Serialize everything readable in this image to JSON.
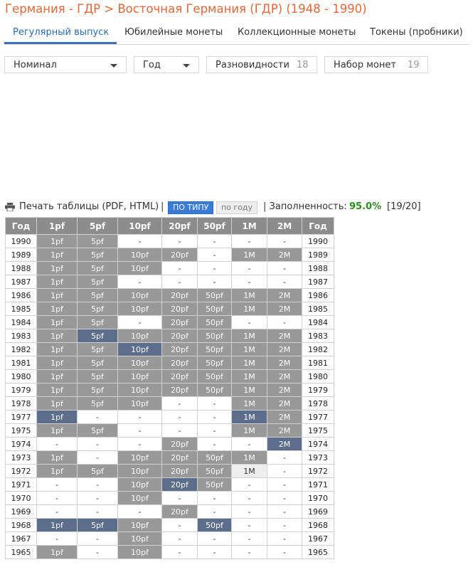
{
  "header": {
    "country": "Германия - ГДР",
    "separator": ">",
    "period": "Восточная Германия (ГДР) (1948 - 1990)"
  },
  "tabs": [
    {
      "label": "Регулярный выпуск",
      "active": true
    },
    {
      "label": "Юбилейные монеты",
      "active": false
    },
    {
      "label": "Коллекционные монеты",
      "active": false
    },
    {
      "label": "Токены (пробники)",
      "active": false
    }
  ],
  "filters": {
    "denomination": "Номинал",
    "year": "Год",
    "varieties": {
      "label": "Разновидности",
      "count": "18"
    },
    "coin_set": {
      "label": "Набор монет",
      "count": "19"
    }
  },
  "toolbar": {
    "print_label": "Печать таблицы (PDF, HTML)",
    "pipe": "|",
    "by_type": "ПО ТИПУ",
    "by_year": "по году",
    "completeness_label": "| Заполненность:",
    "completeness_value": "95.0%",
    "completeness_count": "[19/20]"
  },
  "colors": {
    "title": "#e0693d",
    "tab_active": "#2b6cb0",
    "tab_underline": "#3f72b4",
    "cell_owned": "#999999",
    "cell_highlight": "#5d6e8c",
    "cell_light": "#eeeeee",
    "completeness": "#2e8b1f",
    "button_active": "#3a7bd5"
  },
  "table": {
    "headers": [
      "Год",
      "1pf",
      "5pf",
      "10pf",
      "20pf",
      "50pf",
      "1M",
      "2M",
      "Год"
    ],
    "rows": [
      {
        "year": "1990",
        "cells": [
          {
            "t": "1pf",
            "s": "g"
          },
          {
            "t": "5pf",
            "s": "g"
          },
          {
            "t": "-",
            "s": "e"
          },
          {
            "t": "-",
            "s": "e"
          },
          {
            "t": "-",
            "s": "e"
          },
          {
            "t": "-",
            "s": "e"
          },
          {
            "t": "-",
            "s": "e"
          }
        ]
      },
      {
        "year": "1989",
        "cells": [
          {
            "t": "1pf",
            "s": "g"
          },
          {
            "t": "5pf",
            "s": "g"
          },
          {
            "t": "10pf",
            "s": "g"
          },
          {
            "t": "20pf",
            "s": "g"
          },
          {
            "t": "-",
            "s": "e"
          },
          {
            "t": "1M",
            "s": "g"
          },
          {
            "t": "2M",
            "s": "g"
          }
        ]
      },
      {
        "year": "1988",
        "cells": [
          {
            "t": "1pf",
            "s": "g"
          },
          {
            "t": "5pf",
            "s": "g"
          },
          {
            "t": "10pf",
            "s": "g"
          },
          {
            "t": "-",
            "s": "e"
          },
          {
            "t": "-",
            "s": "e"
          },
          {
            "t": "-",
            "s": "e"
          },
          {
            "t": "-",
            "s": "e"
          }
        ]
      },
      {
        "year": "1987",
        "cells": [
          {
            "t": "1pf",
            "s": "g"
          },
          {
            "t": "5pf",
            "s": "g"
          },
          {
            "t": "-",
            "s": "e"
          },
          {
            "t": "-",
            "s": "e"
          },
          {
            "t": "-",
            "s": "e"
          },
          {
            "t": "-",
            "s": "e"
          },
          {
            "t": "-",
            "s": "e"
          }
        ]
      },
      {
        "year": "1986",
        "cells": [
          {
            "t": "1pf",
            "s": "g"
          },
          {
            "t": "5pf",
            "s": "g"
          },
          {
            "t": "10pf",
            "s": "g"
          },
          {
            "t": "20pf",
            "s": "g"
          },
          {
            "t": "50pf",
            "s": "g"
          },
          {
            "t": "1M",
            "s": "g"
          },
          {
            "t": "2M",
            "s": "g"
          }
        ]
      },
      {
        "year": "1985",
        "cells": [
          {
            "t": "1pf",
            "s": "g"
          },
          {
            "t": "5pf",
            "s": "g"
          },
          {
            "t": "10pf",
            "s": "g"
          },
          {
            "t": "20pf",
            "s": "g"
          },
          {
            "t": "50pf",
            "s": "g"
          },
          {
            "t": "1M",
            "s": "g"
          },
          {
            "t": "2M",
            "s": "g"
          }
        ]
      },
      {
        "year": "1984",
        "cells": [
          {
            "t": "1pf",
            "s": "g"
          },
          {
            "t": "5pf",
            "s": "g"
          },
          {
            "t": "-",
            "s": "e"
          },
          {
            "t": "20pf",
            "s": "g"
          },
          {
            "t": "50pf",
            "s": "g"
          },
          {
            "t": "-",
            "s": "e"
          },
          {
            "t": "-",
            "s": "e"
          }
        ]
      },
      {
        "year": "1983",
        "cells": [
          {
            "t": "1pf",
            "s": "g"
          },
          {
            "t": "5pf",
            "s": "b"
          },
          {
            "t": "10pf",
            "s": "g"
          },
          {
            "t": "20pf",
            "s": "g"
          },
          {
            "t": "50pf",
            "s": "g"
          },
          {
            "t": "1M",
            "s": "g"
          },
          {
            "t": "2M",
            "s": "g"
          }
        ]
      },
      {
        "year": "1982",
        "cells": [
          {
            "t": "1pf",
            "s": "g"
          },
          {
            "t": "5pf",
            "s": "g"
          },
          {
            "t": "10pf",
            "s": "b"
          },
          {
            "t": "20pf",
            "s": "g"
          },
          {
            "t": "50pf",
            "s": "g"
          },
          {
            "t": "1M",
            "s": "g"
          },
          {
            "t": "2M",
            "s": "g"
          }
        ]
      },
      {
        "year": "1981",
        "cells": [
          {
            "t": "1pf",
            "s": "g"
          },
          {
            "t": "5pf",
            "s": "g"
          },
          {
            "t": "10pf",
            "s": "g"
          },
          {
            "t": "20pf",
            "s": "g"
          },
          {
            "t": "50pf",
            "s": "g"
          },
          {
            "t": "1M",
            "s": "g"
          },
          {
            "t": "2M",
            "s": "g"
          }
        ]
      },
      {
        "year": "1980",
        "cells": [
          {
            "t": "1pf",
            "s": "g"
          },
          {
            "t": "5pf",
            "s": "g"
          },
          {
            "t": "10pf",
            "s": "g"
          },
          {
            "t": "20pf",
            "s": "g"
          },
          {
            "t": "50pf",
            "s": "g"
          },
          {
            "t": "1M",
            "s": "g"
          },
          {
            "t": "2M",
            "s": "g"
          }
        ]
      },
      {
        "year": "1979",
        "cells": [
          {
            "t": "1pf",
            "s": "g"
          },
          {
            "t": "5pf",
            "s": "g"
          },
          {
            "t": "10pf",
            "s": "g"
          },
          {
            "t": "20pf",
            "s": "g"
          },
          {
            "t": "50pf",
            "s": "g"
          },
          {
            "t": "1M",
            "s": "g"
          },
          {
            "t": "2M",
            "s": "g"
          }
        ]
      },
      {
        "year": "1978",
        "cells": [
          {
            "t": "1pf",
            "s": "g"
          },
          {
            "t": "5pf",
            "s": "g"
          },
          {
            "t": "10pf",
            "s": "g"
          },
          {
            "t": "-",
            "s": "e"
          },
          {
            "t": "-",
            "s": "e"
          },
          {
            "t": "1M",
            "s": "g"
          },
          {
            "t": "2M",
            "s": "g"
          }
        ]
      },
      {
        "year": "1977",
        "cells": [
          {
            "t": "1pf",
            "s": "b"
          },
          {
            "t": "-",
            "s": "e"
          },
          {
            "t": "-",
            "s": "e"
          },
          {
            "t": "-",
            "s": "e"
          },
          {
            "t": "-",
            "s": "e"
          },
          {
            "t": "1M",
            "s": "b"
          },
          {
            "t": "2M",
            "s": "g"
          }
        ]
      },
      {
        "year": "1975",
        "cells": [
          {
            "t": "1pf",
            "s": "g"
          },
          {
            "t": "5pf",
            "s": "g"
          },
          {
            "t": "-",
            "s": "e"
          },
          {
            "t": "-",
            "s": "e"
          },
          {
            "t": "-",
            "s": "e"
          },
          {
            "t": "1M",
            "s": "g"
          },
          {
            "t": "2M",
            "s": "g"
          }
        ]
      },
      {
        "year": "1974",
        "cells": [
          {
            "t": "-",
            "s": "e"
          },
          {
            "t": "-",
            "s": "e"
          },
          {
            "t": "-",
            "s": "e"
          },
          {
            "t": "20pf",
            "s": "g"
          },
          {
            "t": "-",
            "s": "e"
          },
          {
            "t": "-",
            "s": "e"
          },
          {
            "t": "2M",
            "s": "b"
          }
        ]
      },
      {
        "year": "1973",
        "cells": [
          {
            "t": "1pf",
            "s": "g"
          },
          {
            "t": "-",
            "s": "e"
          },
          {
            "t": "10pf",
            "s": "g"
          },
          {
            "t": "20pf",
            "s": "g"
          },
          {
            "t": "50pf",
            "s": "g"
          },
          {
            "t": "1M",
            "s": "g"
          },
          {
            "t": "-",
            "s": "e"
          }
        ]
      },
      {
        "year": "1972",
        "cells": [
          {
            "t": "1pf",
            "s": "g"
          },
          {
            "t": "5pf",
            "s": "g"
          },
          {
            "t": "10pf",
            "s": "g"
          },
          {
            "t": "20pf",
            "s": "g"
          },
          {
            "t": "50pf",
            "s": "g"
          },
          {
            "t": "1M",
            "s": "l"
          },
          {
            "t": "-",
            "s": "e"
          }
        ]
      },
      {
        "year": "1971",
        "cells": [
          {
            "t": "-",
            "s": "e"
          },
          {
            "t": "-",
            "s": "e"
          },
          {
            "t": "10pf",
            "s": "g"
          },
          {
            "t": "20pf",
            "s": "b"
          },
          {
            "t": "50pf",
            "s": "g"
          },
          {
            "t": "-",
            "s": "e"
          },
          {
            "t": "-",
            "s": "e"
          }
        ]
      },
      {
        "year": "1970",
        "cells": [
          {
            "t": "-",
            "s": "e"
          },
          {
            "t": "-",
            "s": "e"
          },
          {
            "t": "10pf",
            "s": "g"
          },
          {
            "t": "-",
            "s": "e"
          },
          {
            "t": "-",
            "s": "e"
          },
          {
            "t": "-",
            "s": "e"
          },
          {
            "t": "-",
            "s": "e"
          }
        ]
      },
      {
        "year": "1969",
        "cells": [
          {
            "t": "-",
            "s": "e"
          },
          {
            "t": "-",
            "s": "e"
          },
          {
            "t": "-",
            "s": "e"
          },
          {
            "t": "20pf",
            "s": "g"
          },
          {
            "t": "-",
            "s": "e"
          },
          {
            "t": "-",
            "s": "e"
          },
          {
            "t": "-",
            "s": "e"
          }
        ]
      },
      {
        "year": "1968",
        "cells": [
          {
            "t": "1pf",
            "s": "b"
          },
          {
            "t": "5pf",
            "s": "b"
          },
          {
            "t": "10pf",
            "s": "g"
          },
          {
            "t": "-",
            "s": "e"
          },
          {
            "t": "50pf",
            "s": "b"
          },
          {
            "t": "-",
            "s": "e"
          },
          {
            "t": "-",
            "s": "e"
          }
        ]
      },
      {
        "year": "1967",
        "cells": [
          {
            "t": "-",
            "s": "e"
          },
          {
            "t": "-",
            "s": "e"
          },
          {
            "t": "10pf",
            "s": "g"
          },
          {
            "t": "-",
            "s": "e"
          },
          {
            "t": "-",
            "s": "e"
          },
          {
            "t": "-",
            "s": "e"
          },
          {
            "t": "-",
            "s": "e"
          }
        ]
      },
      {
        "year": "1965",
        "cells": [
          {
            "t": "1pf",
            "s": "g"
          },
          {
            "t": "-",
            "s": "e"
          },
          {
            "t": "10pf",
            "s": "g"
          },
          {
            "t": "-",
            "s": "e"
          },
          {
            "t": "-",
            "s": "e"
          },
          {
            "t": "-",
            "s": "e"
          },
          {
            "t": "-",
            "s": "e"
          }
        ]
      }
    ]
  }
}
